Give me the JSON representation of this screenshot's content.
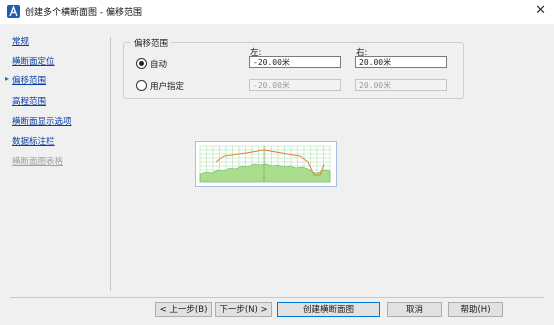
{
  "window": {
    "title": "创建多个横断面图 - 偏移范围",
    "close_glyph": "✕"
  },
  "nav": {
    "items": [
      {
        "label": "常规"
      },
      {
        "label": "横断面定位"
      },
      {
        "label": "偏移范围",
        "selected": true
      },
      {
        "label": "高程范围"
      },
      {
        "label": "横断面显示选项"
      },
      {
        "label": "数据标注栏"
      },
      {
        "label": "横断面图表格",
        "disabled": true
      }
    ],
    "selected_marker": "▸"
  },
  "offset_group": {
    "title": "偏移范围",
    "left_label": "左:",
    "right_label": "右:",
    "auto": {
      "label": "自动",
      "selected": true,
      "left_value": "-20.00米",
      "right_value": "20.00米"
    },
    "user": {
      "label": "用户指定",
      "selected": false,
      "left_value": "-20.00米",
      "right_value": "20.00米"
    }
  },
  "footer": {
    "prev_label": "< 上一步(B)",
    "next_label": "下一步(N) >",
    "create_label": "创建横断面图",
    "cancel_label": "取消",
    "help_label": "帮助(H)"
  },
  "colors": {
    "link": "#0a3ca8",
    "disabled": "#a0a0a0",
    "grid": "#8ad08a",
    "ground_fill": "#a9df8c",
    "design_line": "#e67d2a",
    "accent": "#0078d7"
  }
}
